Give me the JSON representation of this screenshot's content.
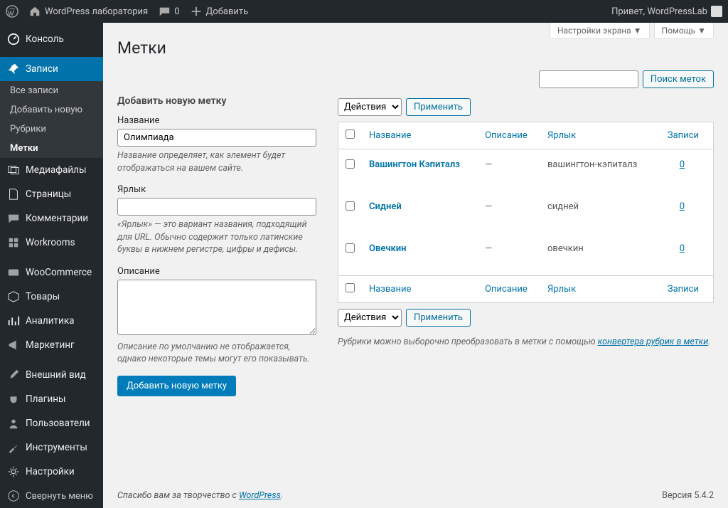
{
  "toolbar": {
    "site": "WordPress лаборатория",
    "comments": "0",
    "add": "Добавить",
    "greeting": "Привет, WordPressLab"
  },
  "menu": {
    "dashboard": "Консоль",
    "posts": "Записи",
    "posts_sub": {
      "all": "Все записи",
      "new": "Добавить новую",
      "cats": "Рубрики",
      "tags": "Метки"
    },
    "media": "Медиафайлы",
    "pages": "Страницы",
    "comments": "Комментарии",
    "workrooms": "Workrooms",
    "woo": "WooCommerce",
    "products": "Товары",
    "analytics": "Аналитика",
    "marketing": "Маркетинг",
    "appearance": "Внешний вид",
    "plugins": "Плагины",
    "users": "Пользователи",
    "tools": "Инструменты",
    "settings": "Настройки",
    "collapse": "Свернуть меню"
  },
  "screen": {
    "options": "Настройки экрана",
    "help": "Помощь"
  },
  "page_title": "Метки",
  "search": {
    "button": "Поиск меток"
  },
  "form": {
    "heading": "Добавить новую метку",
    "name_label": "Название",
    "name_value": "Олимпиада",
    "name_desc": "Название определяет, как элемент будет отображаться на вашем сайте.",
    "slug_label": "Ярлык",
    "slug_desc": "«Ярлык» — это вариант названия, подходящий для URL. Обычно содержит только латинские буквы в нижнем регистре, цифры и дефисы.",
    "desc_label": "Описание",
    "desc_desc": "Описание по умолчанию не отображается, однако некоторые темы могут его показывать.",
    "submit": "Добавить новую метку"
  },
  "bulk": {
    "actions": "Действия",
    "apply": "Применить"
  },
  "table": {
    "cols": {
      "name": "Название",
      "desc": "Описание",
      "slug": "Ярлык",
      "posts": "Записи"
    },
    "rows": [
      {
        "name": "Вашингтон Кэпиталз",
        "desc": "—",
        "slug": "вашингтон-кэпиталз",
        "posts": "0"
      },
      {
        "name": "Сидней",
        "desc": "—",
        "slug": "сидней",
        "posts": "0"
      },
      {
        "name": "Овечкин",
        "desc": "—",
        "slug": "овечкин",
        "posts": "0"
      }
    ]
  },
  "note": {
    "text": "Рубрики можно выборочно преобразовать в метки с помощью ",
    "link": "конвертера рубрик в метки",
    "suffix": "."
  },
  "footer": {
    "thanks": "Спасибо вам за творчество с ",
    "wp": "WordPress",
    "dot": ".",
    "version": "Версия 5.4.2"
  }
}
